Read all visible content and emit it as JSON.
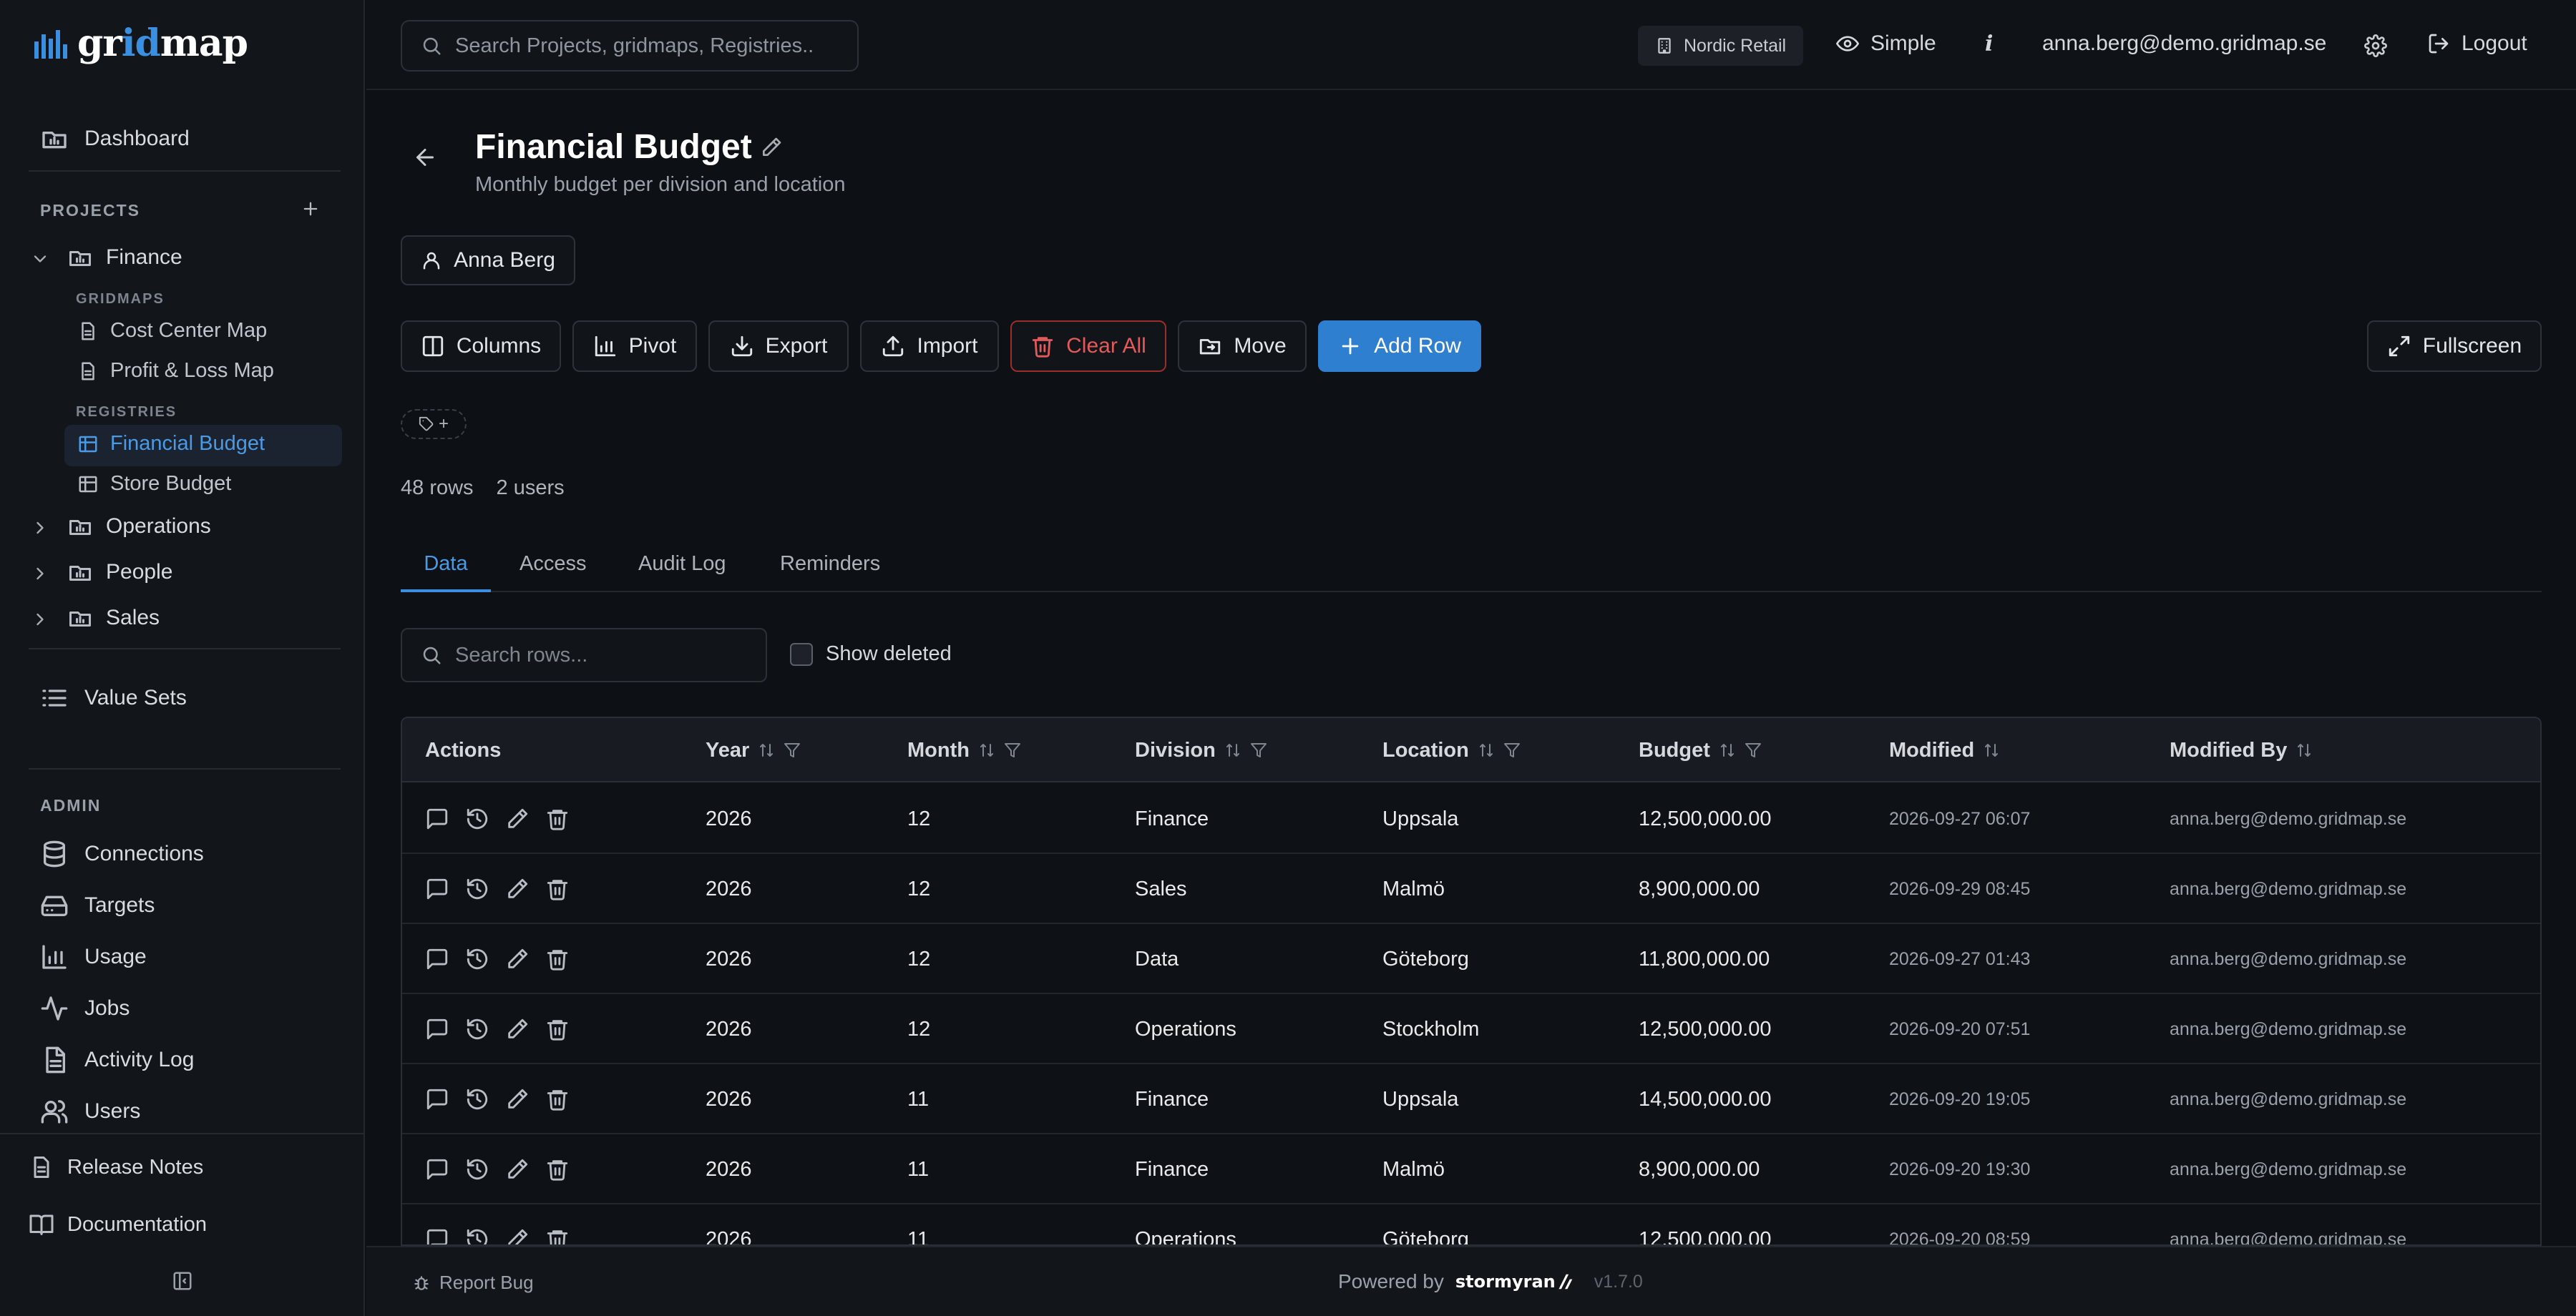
{
  "app": {
    "logo_prefix": "gr",
    "logo_accent": "id",
    "logo_suffix": "map",
    "brand_color": "#3b8fe0"
  },
  "topbar": {
    "search_placeholder": "Search Projects, gridmaps, Registries..",
    "org": "Nordic Retail",
    "view_mode": "Simple",
    "info": "i",
    "user_email": "anna.berg@demo.gridmap.se",
    "logout": "Logout"
  },
  "sidebar": {
    "dashboard": "Dashboard",
    "projects_label": "PROJECTS",
    "finance": "Finance",
    "gridmaps_label": "GRIDMAPS",
    "gridmaps": [
      "Cost Center Map",
      "Profit & Loss Map"
    ],
    "registries_label": "REGISTRIES",
    "registries": [
      "Financial Budget",
      "Store Budget"
    ],
    "projects": [
      "Operations",
      "People",
      "Sales"
    ],
    "value_sets": "Value Sets",
    "admin_label": "ADMIN",
    "admin": [
      "Connections",
      "Targets",
      "Usage",
      "Jobs",
      "Activity Log",
      "Users"
    ],
    "release_notes": "Release Notes",
    "documentation": "Documentation"
  },
  "page": {
    "title": "Financial Budget",
    "subtitle": "Monthly budget per division and location",
    "owner": "Anna Berg",
    "stats_rows": "48 rows",
    "stats_users": "2 users"
  },
  "toolbar": {
    "columns": "Columns",
    "pivot": "Pivot",
    "export": "Export",
    "import": "Import",
    "clear_all": "Clear All",
    "move": "Move",
    "add_row": "Add Row",
    "fullscreen": "Fullscreen",
    "tag_add": "+"
  },
  "tabs": [
    "Data",
    "Access",
    "Audit Log",
    "Reminders"
  ],
  "filters": {
    "search_placeholder": "Search rows...",
    "show_deleted": "Show deleted"
  },
  "table": {
    "headers": [
      "Actions",
      "Year",
      "Month",
      "Division",
      "Location",
      "Budget",
      "Modified",
      "Modified By"
    ],
    "rows": [
      {
        "year": "2026",
        "month": "12",
        "division": "Finance",
        "location": "Uppsala",
        "budget": "12,500,000.00",
        "modified": "2026-09-27 06:07",
        "by": "anna.berg@demo.gridmap.se"
      },
      {
        "year": "2026",
        "month": "12",
        "division": "Sales",
        "location": "Malmö",
        "budget": "8,900,000.00",
        "modified": "2026-09-29 08:45",
        "by": "anna.berg@demo.gridmap.se"
      },
      {
        "year": "2026",
        "month": "12",
        "division": "Data",
        "location": "Göteborg",
        "budget": "11,800,000.00",
        "modified": "2026-09-27 01:43",
        "by": "anna.berg@demo.gridmap.se"
      },
      {
        "year": "2026",
        "month": "12",
        "division": "Operations",
        "location": "Stockholm",
        "budget": "12,500,000.00",
        "modified": "2026-09-20 07:51",
        "by": "anna.berg@demo.gridmap.se"
      },
      {
        "year": "2026",
        "month": "11",
        "division": "Finance",
        "location": "Uppsala",
        "budget": "14,500,000.00",
        "modified": "2026-09-20 19:05",
        "by": "anna.berg@demo.gridmap.se"
      },
      {
        "year": "2026",
        "month": "11",
        "division": "Finance",
        "location": "Malmö",
        "budget": "8,900,000.00",
        "modified": "2026-09-20 19:30",
        "by": "anna.berg@demo.gridmap.se"
      },
      {
        "year": "2026",
        "month": "11",
        "division": "Operations",
        "location": "Göteborg",
        "budget": "12,500,000.00",
        "modified": "2026-09-20 08:59",
        "by": "anna.berg@demo.gridmap.se"
      }
    ]
  },
  "footer": {
    "report_bug": "Report Bug",
    "powered_by": "Powered by",
    "brand": "stormyran",
    "version": "v1.7.0"
  }
}
